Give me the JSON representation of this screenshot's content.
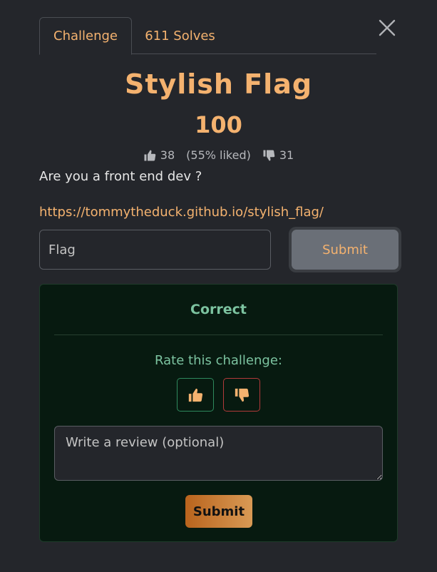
{
  "tabs": [
    {
      "label": "Challenge"
    },
    {
      "label": "611 Solves"
    }
  ],
  "challenge": {
    "title": "Stylish Flag",
    "points": "100",
    "likes": "38",
    "liked_pct": "(55% liked)",
    "dislikes": "31",
    "description": "Are you a front end dev ?",
    "link": "https://tommytheduck.github.io/stylish_flag/"
  },
  "flag_form": {
    "placeholder": "Flag",
    "submit_label": "Submit"
  },
  "result": {
    "status": "Correct",
    "rate_label": "Rate this challenge:",
    "review_placeholder": "Write a review (optional)",
    "submit_label": "Submit"
  },
  "icons": {
    "close": "close-icon",
    "like": "thumbs-up-icon",
    "dislike": "thumbs-down-icon"
  },
  "colors": {
    "accent": "#f4b26f",
    "success": "#7cc3a0",
    "background": "#24262b",
    "result_background": "#071a10"
  }
}
